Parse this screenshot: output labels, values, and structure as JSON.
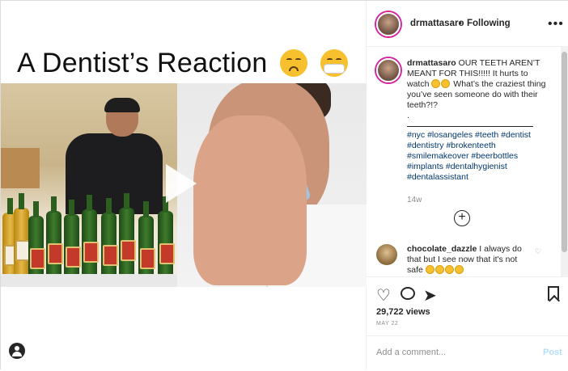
{
  "media": {
    "title": "A Dentist’s Reaction"
  },
  "header": {
    "username": "drmattasaro",
    "separator": "•",
    "follow_state": "Following",
    "more": "•••"
  },
  "caption": {
    "username": "drmattasaro",
    "text_1": "OUR TEETH AREN’T MEANT FOR THIS!!!!! It hurts to watch",
    "text_2": "What’s the craziest thing you’ve seen someone do with their teeth?!?",
    "dot": ".",
    "hashtags": "#nyc #losangeles #teeth #dentist #dentistry #brokenteeth #smilemakeover #beerbottles #implants #dentalhygienist #dentalassistant",
    "time": "14w"
  },
  "comment": {
    "username": "chocolate_dazzle",
    "text": "I always do that but I see now that it's not safe"
  },
  "footer": {
    "views": "29,722 views",
    "date": "MAY 22",
    "add_comment_placeholder": "Add a comment...",
    "post_label": "Post"
  },
  "colors": {
    "link": "#00376b",
    "post_disabled": "#b2dffc",
    "text": "#262626",
    "muted": "#8e8e8e"
  }
}
